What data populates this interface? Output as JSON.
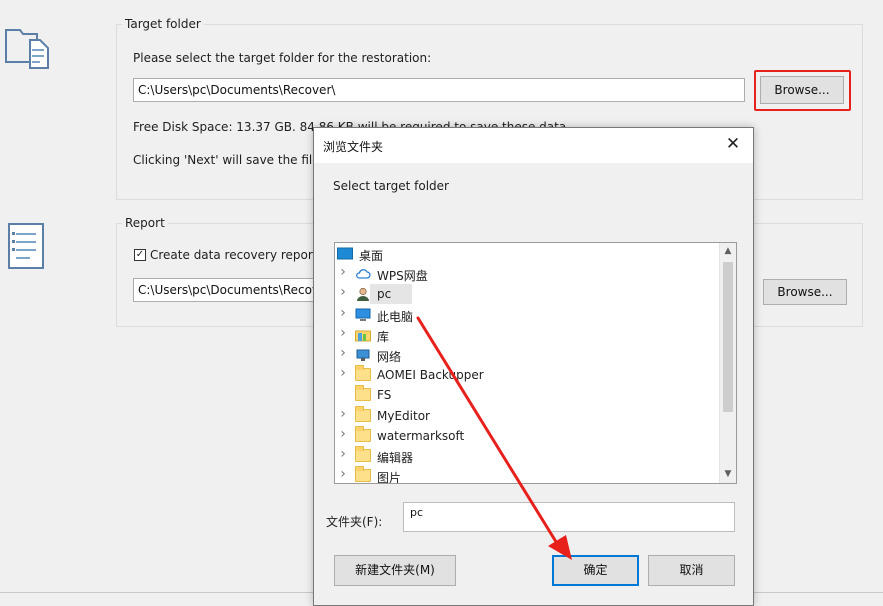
{
  "target_group": {
    "label": "Target folder",
    "prompt": "Please select the target folder for the restoration:",
    "path_value": "C:\\Users\\pc\\Documents\\Recover\\",
    "browse_label": "Browse...",
    "free_space": "Free Disk Space: 13.37 GB. 84.86 KB will be required to save these data.",
    "next_info": "Clicking 'Next' will save the file"
  },
  "report_group": {
    "label": "Report",
    "checkbox_label": "Create data recovery report",
    "checkbox_checked": true,
    "path_value": "C:\\Users\\pc\\Documents\\Recove",
    "browse_label": "Browse..."
  },
  "dialog": {
    "title": "浏览文件夹",
    "close_glyph": "✕",
    "instruction": "Select target folder",
    "tree": [
      {
        "label": "桌面",
        "icon": "desktop-icon",
        "level": 0,
        "expandable": false
      },
      {
        "label": "WPS网盘",
        "icon": "cloud-icon",
        "level": 1,
        "expandable": true
      },
      {
        "label": "pc",
        "icon": "user-icon",
        "level": 1,
        "expandable": true,
        "selected": true
      },
      {
        "label": "此电脑",
        "icon": "computer-icon",
        "level": 1,
        "expandable": true
      },
      {
        "label": "库",
        "icon": "library-icon",
        "level": 1,
        "expandable": true
      },
      {
        "label": "网络",
        "icon": "network-icon",
        "level": 1,
        "expandable": true
      },
      {
        "label": "AOMEI Backupper",
        "icon": "folder-icon",
        "level": 1,
        "expandable": true
      },
      {
        "label": "FS",
        "icon": "folder-icon",
        "level": 1,
        "expandable": false
      },
      {
        "label": "MyEditor",
        "icon": "folder-icon",
        "level": 1,
        "expandable": true
      },
      {
        "label": "watermarksoft",
        "icon": "folder-icon",
        "level": 1,
        "expandable": true
      },
      {
        "label": "编辑器",
        "icon": "folder-icon",
        "level": 1,
        "expandable": true
      },
      {
        "label": "图片",
        "icon": "folder-icon",
        "level": 1,
        "expandable": true
      }
    ],
    "folder_label": "文件夹(F):",
    "folder_value": "pc",
    "new_folder_label": "新建文件夹(M)",
    "ok_label": "确定",
    "cancel_label": "取消"
  },
  "colors": {
    "highlight_red": "#e8201c",
    "default_button_border": "#0078d7"
  }
}
